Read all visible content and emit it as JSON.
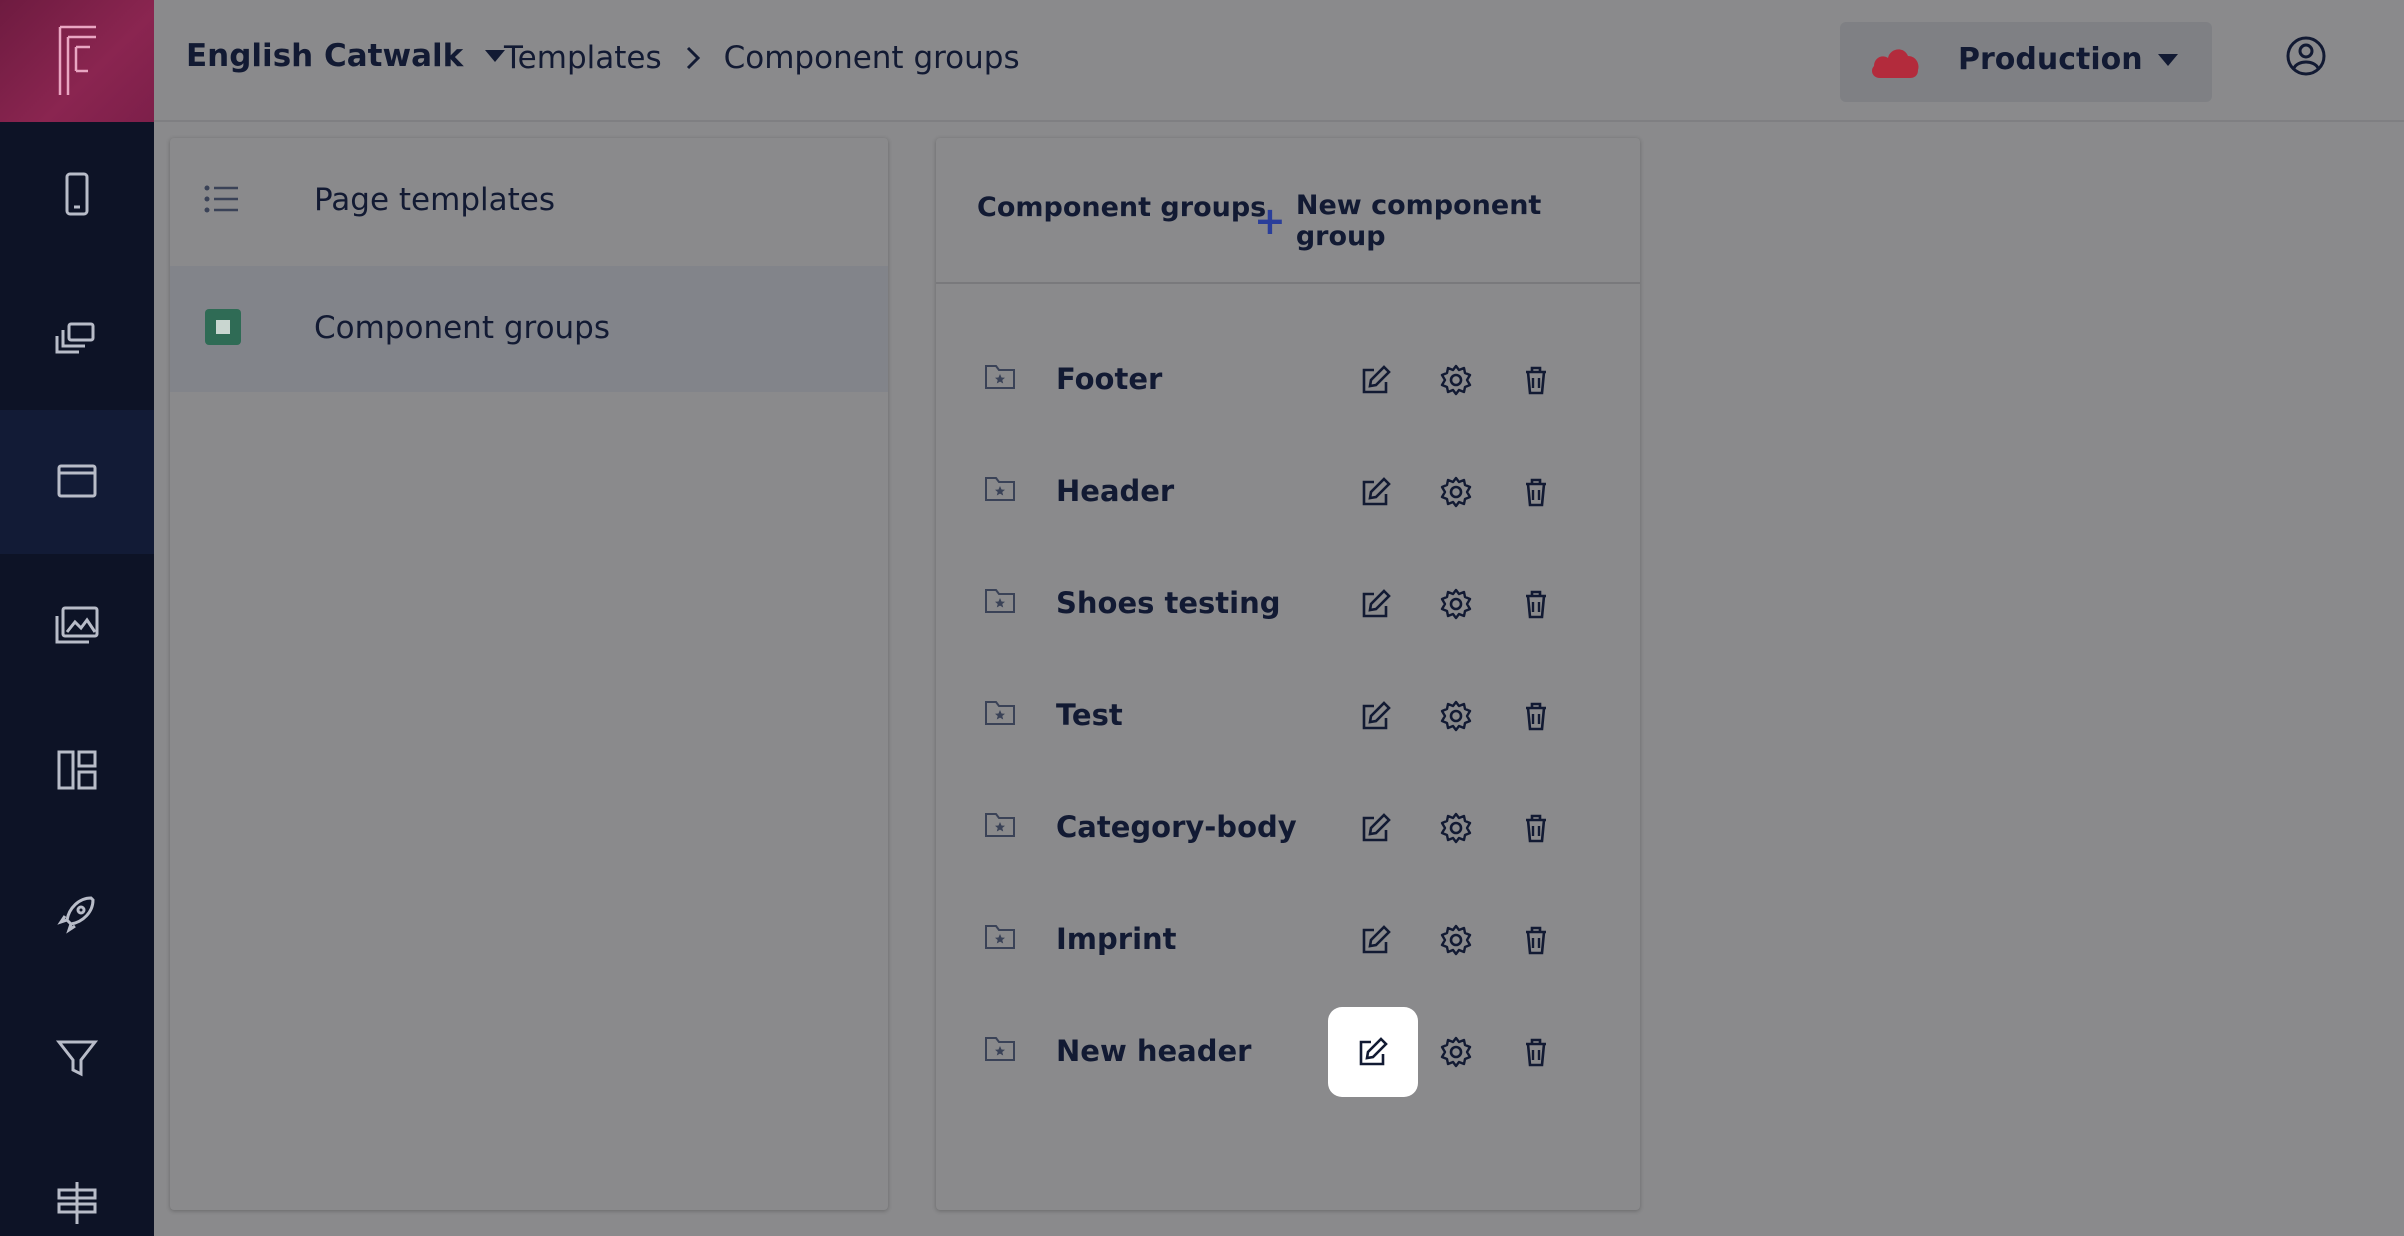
{
  "topbar": {
    "project_name": "English Catwalk",
    "breadcrumbs": [
      "Templates",
      "Component groups"
    ],
    "environment": "Production"
  },
  "rail": {
    "items": [
      "phone-icon",
      "copy-icon",
      "window-icon",
      "images-icon",
      "dashboard-icon",
      "rocket-icon",
      "filter-icon",
      "signpost-icon"
    ],
    "active_index": 2
  },
  "left_panel": {
    "items": [
      {
        "label": "Page templates",
        "icon": "list-icon"
      },
      {
        "label": "Component groups",
        "icon": "square-icon"
      }
    ],
    "selected_index": 1
  },
  "right_panel": {
    "title": "Component groups",
    "new_button": "New component group",
    "groups": [
      {
        "name": "Footer"
      },
      {
        "name": "Header"
      },
      {
        "name": "Shoes testing"
      },
      {
        "name": "Test"
      },
      {
        "name": "Category-body"
      },
      {
        "name": "Imprint"
      },
      {
        "name": "New header"
      }
    ],
    "highlighted_edit_index": 6
  },
  "colors": {
    "rail": "#0d1326",
    "logo": "#8a2550",
    "accent_plus": "#2a3e9a",
    "cloud": "#b32b3c",
    "selected_square": "#2f6b55"
  }
}
